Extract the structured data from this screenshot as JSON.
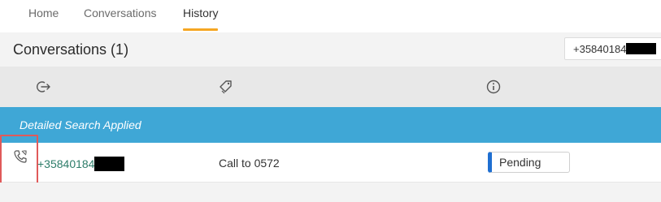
{
  "nav": {
    "tabs": [
      {
        "label": "Home"
      },
      {
        "label": "Conversations"
      },
      {
        "label": "History"
      }
    ],
    "active_tab": "History",
    "accent_color": "#f5a623"
  },
  "header": {
    "title": "Conversations (1)",
    "search_value": "+35840184"
  },
  "columns": {
    "icons": [
      "direction-icon",
      "tag-icon",
      "info-icon"
    ]
  },
  "banner": {
    "text": "Detailed Search Applied",
    "color": "#3fa7d6"
  },
  "rows": [
    {
      "type_icon": "phone-call-icon",
      "caller": "+35840184",
      "subject": "Call to 0572",
      "status": "Pending",
      "status_color": "#1f6fd1"
    }
  ]
}
